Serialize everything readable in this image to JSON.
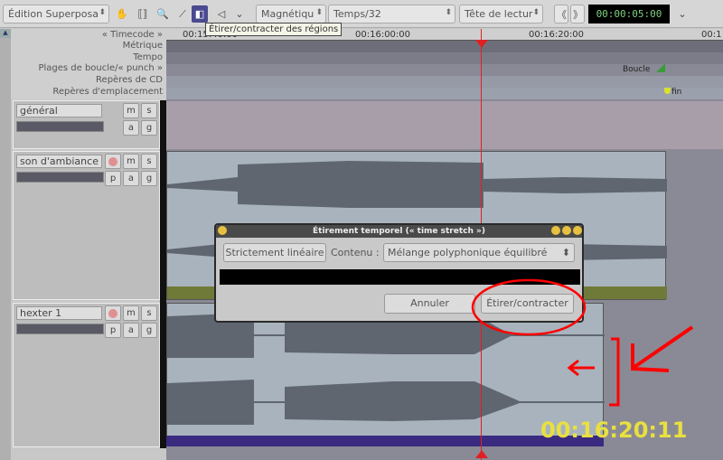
{
  "toolbar": {
    "edit_mode": "Édition Superposa",
    "snap_mode": "Magnétiqu",
    "grid": "Temps/32",
    "edit_point": "Tête de lectur",
    "clock": "00:00:05:00",
    "tooltip": "Étirer/contracter des régions",
    "tools": [
      "grab-hand-icon",
      "range-icon",
      "zoom-icon",
      "draw-gain-icon",
      "timefx-icon",
      "audition-icon",
      "chevron-down-icon"
    ]
  },
  "rulers": {
    "labels": [
      "« Timecode »",
      "Métrique",
      "Tempo",
      "Plages de boucle/« punch »",
      "Repères de CD",
      "Repères d'emplacement"
    ],
    "ticks": [
      "00:15:40:00",
      "00:16:00:00",
      "00:16:20:00",
      "00:1"
    ],
    "loop_marker": "Boucle",
    "end_marker": "fin"
  },
  "tracks": [
    {
      "name": "général",
      "buttons": [
        "m",
        "s",
        "a",
        "g"
      ]
    },
    {
      "name": "son d'ambiance",
      "buttons": [
        "m",
        "s",
        "p",
        "a",
        "g"
      ]
    },
    {
      "name": "hexter 1",
      "buttons": [
        "m",
        "s",
        "p",
        "a",
        "g"
      ]
    }
  ],
  "dialog": {
    "title": "Étirement temporel (« time stretch »)",
    "linear": "Strictement linéaire",
    "content_label": "Contenu :",
    "content_value": "Mélange polyphonique équilibré",
    "cancel": "Annuler",
    "ok": "Étirer/contracter"
  },
  "annotation": {
    "timecode": "00:16:20:11",
    "color": "#e8e040",
    "mark_color": "#ff0000"
  },
  "colors": {
    "playhead": "#e02020",
    "region": "#a8b3be",
    "region_bar_1": "#707a38",
    "region_bar_2": "#3a2a80"
  }
}
